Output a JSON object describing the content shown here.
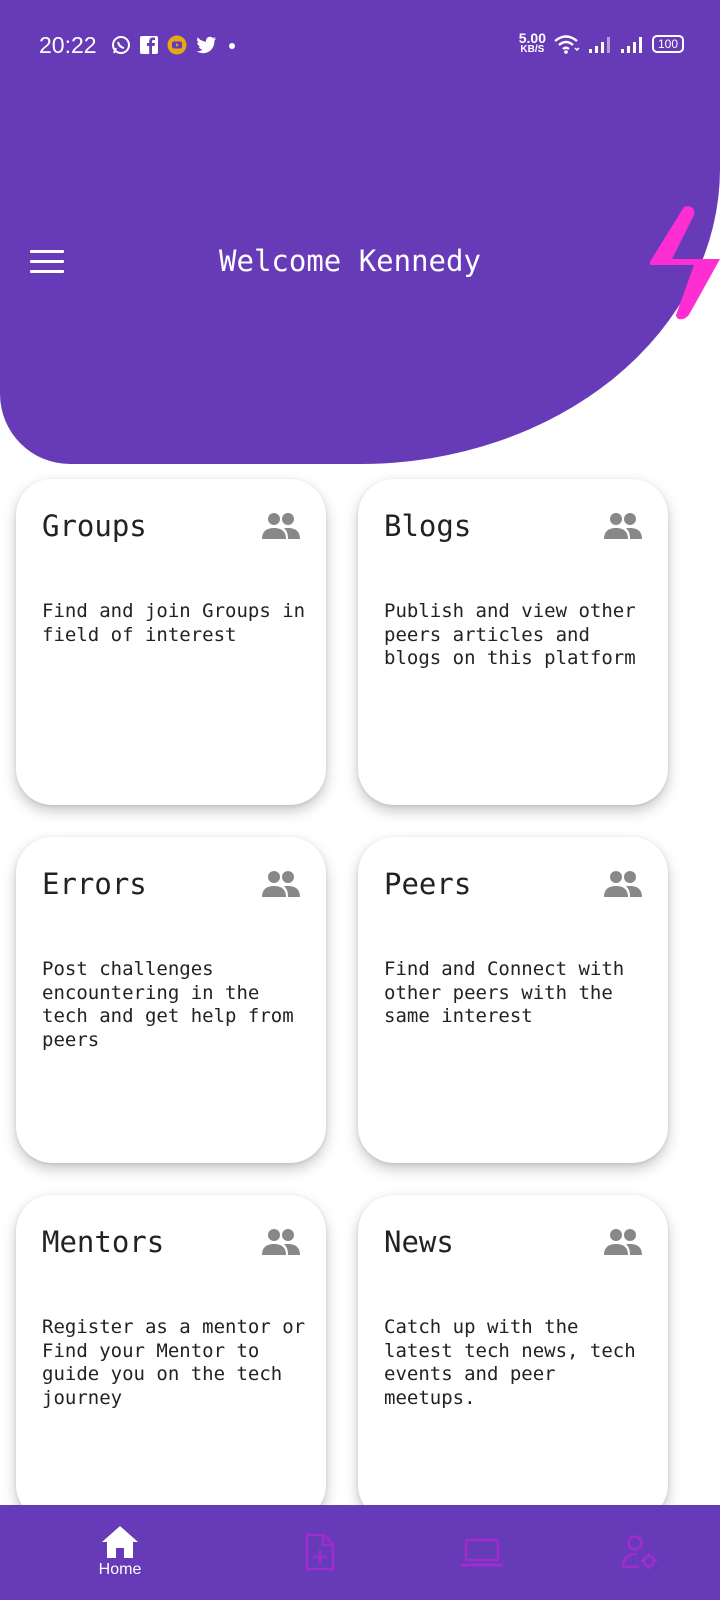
{
  "status_bar": {
    "time": "20:22",
    "notification_icons": [
      "whatsapp-icon",
      "facebook-icon",
      "youtube-icon",
      "twitter-icon",
      "dot-icon"
    ],
    "net_speed_value": "5.00",
    "net_speed_unit": "KB/S",
    "battery": "100"
  },
  "header": {
    "title": "Welcome Kennedy",
    "menu_icon": "hamburger-icon",
    "brand_icon": "lightning-bolt-icon",
    "background_color": "#673ab7",
    "accent_color": "#ff2ed2"
  },
  "cards": [
    {
      "title": "Groups",
      "icon": "people-icon",
      "description": "Find and join Groups in field of interest"
    },
    {
      "title": "Blogs",
      "icon": "people-icon",
      "description": "Publish and view other peers articles and blogs on this platform"
    },
    {
      "title": "Errors",
      "icon": "people-icon",
      "description": "Post challenges encountering in the tech and get help from peers"
    },
    {
      "title": "Peers",
      "icon": "people-icon",
      "description": "Find and Connect with other peers with the same interest"
    },
    {
      "title": "Mentors",
      "icon": "people-icon",
      "description": "Register as a mentor or Find your Mentor to guide you on the tech journey"
    },
    {
      "title": "News",
      "icon": "people-icon",
      "description": "Catch up with the latest tech news, tech events and peer meetups."
    }
  ],
  "bottom_nav": {
    "items": [
      {
        "label": "Home",
        "icon": "home-icon",
        "active": true
      },
      {
        "label": "",
        "icon": "add-document-icon",
        "active": false
      },
      {
        "label": "",
        "icon": "laptop-icon",
        "active": false
      },
      {
        "label": "",
        "icon": "user-settings-icon",
        "active": false
      }
    ],
    "active_color": "#ffffff",
    "inactive_color": "#a02bcf"
  }
}
